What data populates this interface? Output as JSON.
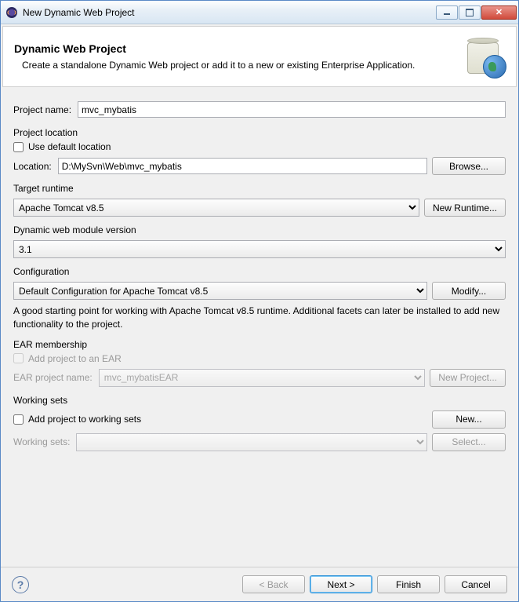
{
  "window": {
    "title": "New Dynamic Web Project"
  },
  "header": {
    "title": "Dynamic Web Project",
    "subtitle": "Create a standalone Dynamic Web project or add it to a new or existing Enterprise Application."
  },
  "project": {
    "name_label": "Project name:",
    "name_value": "mvc_mybatis"
  },
  "location": {
    "legend": "Project location",
    "use_default_label": "Use default location",
    "use_default_checked": false,
    "label": "Location:",
    "value": "D:\\MySvn\\Web\\mvc_mybatis",
    "browse": "Browse..."
  },
  "runtime": {
    "legend": "Target runtime",
    "value": "Apache Tomcat v8.5",
    "new_runtime": "New Runtime..."
  },
  "module": {
    "legend": "Dynamic web module version",
    "value": "3.1"
  },
  "config": {
    "legend": "Configuration",
    "value": "Default Configuration for Apache Tomcat v8.5",
    "modify": "Modify...",
    "hint": "A good starting point for working with Apache Tomcat v8.5 runtime. Additional facets can later be installed to add new functionality to the project."
  },
  "ear": {
    "legend": "EAR membership",
    "add_label": "Add project to an EAR",
    "add_checked": false,
    "name_label": "EAR project name:",
    "name_value": "mvc_mybatisEAR",
    "new_project": "New Project..."
  },
  "ws": {
    "legend": "Working sets",
    "add_label": "Add project to working sets",
    "add_checked": false,
    "new": "New...",
    "sets_label": "Working sets:",
    "sets_value": "",
    "select": "Select..."
  },
  "footer": {
    "back": "< Back",
    "next": "Next >",
    "finish": "Finish",
    "cancel": "Cancel"
  }
}
